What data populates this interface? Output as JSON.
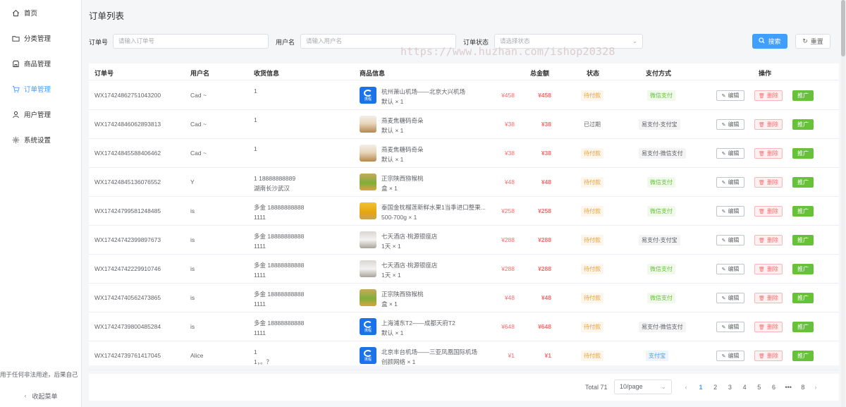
{
  "sidebar": {
    "items": [
      {
        "label": "首页",
        "icon": "home-icon"
      },
      {
        "label": "分类管理",
        "icon": "folder-icon"
      },
      {
        "label": "商品管理",
        "icon": "shop-icon"
      },
      {
        "label": "订单管理",
        "icon": "cart-icon",
        "active": true
      },
      {
        "label": "用户管理",
        "icon": "user-icon"
      },
      {
        "label": "系统设置",
        "icon": "gear-icon"
      }
    ],
    "note": "用于任何非法用途，后果自己",
    "collapse_label": "收起菜单"
  },
  "page_title": "订单列表",
  "filters": {
    "order_no_label": "订单号",
    "order_no_placeholder": "请输入订单号",
    "username_label": "用户名",
    "username_placeholder": "请输入用户名",
    "status_label": "订单状态",
    "status_placeholder": "请选择状态",
    "search_label": "搜索",
    "reset_label": "重置"
  },
  "watermark": "https://www.huzhan.com/ishop20328",
  "table": {
    "headers": [
      "订单号",
      "用户名",
      "收货信息",
      "商品信息",
      "总金额",
      "状态",
      "支付方式",
      "操作"
    ],
    "edit_label": "编辑",
    "delete_label": "删除",
    "promote_label": "推广",
    "rows": [
      {
        "order_no": "WX17424862751043200",
        "user": "Cad ~",
        "ship1": "1",
        "ship2": "",
        "thumb": "blue",
        "goods": "杭州萧山机场——北京大兴机场",
        "spec": "默认 × 1",
        "price": "¥458",
        "total": "¥458",
        "status": "待付款",
        "status_type": "pending",
        "pay": "微信支付",
        "pay_type": "green"
      },
      {
        "order_no": "WX17424846062893813",
        "user": "Cad ~",
        "ship1": "1",
        "ship2": "",
        "thumb": "cup",
        "goods": "燕麦焦糖码奇朵",
        "spec": "默认 × 1",
        "price": "¥38",
        "total": "¥38",
        "status": "已过期",
        "status_type": "expired",
        "pay": "易支付-支付宝",
        "pay_type": "gray"
      },
      {
        "order_no": "WX17424845588406462",
        "user": "Cad ~",
        "ship1": "1",
        "ship2": "",
        "thumb": "cup",
        "goods": "燕麦焦糖码奇朵",
        "spec": "默认 × 1",
        "price": "¥38",
        "total": "¥38",
        "status": "待付款",
        "status_type": "pending",
        "pay": "易支付-微信支付",
        "pay_type": "gray"
      },
      {
        "order_no": "WX17424845136076552",
        "user": "Y",
        "ship1": "1 18888888889",
        "ship2": "湖南长沙武汉",
        "thumb": "kiwi",
        "goods": "正宗陕西猕猴桃",
        "spec": "盒 × 1",
        "price": "¥48",
        "total": "¥48",
        "status": "待付款",
        "status_type": "pending",
        "pay": "微信支付",
        "pay_type": "green"
      },
      {
        "order_no": "WX17424799581248485",
        "user": "is",
        "ship1": "多金 18888888888",
        "ship2": "1111",
        "thumb": "durian",
        "goods": "泰国金枕榴莲新鲜水果1当季进口整果...",
        "spec": "500-700g × 1",
        "price": "¥258",
        "total": "¥258",
        "status": "待付款",
        "status_type": "pending",
        "pay": "微信支付",
        "pay_type": "green"
      },
      {
        "order_no": "WX17424742399897673",
        "user": "is",
        "ship1": "多金 18888888888",
        "ship2": "1111",
        "thumb": "room",
        "goods": "七天酒店·桃源银座店",
        "spec": "1天 × 1",
        "price": "¥288",
        "total": "¥288",
        "status": "待付款",
        "status_type": "pending",
        "pay": "易支付-支付宝",
        "pay_type": "gray"
      },
      {
        "order_no": "WX17424742229910746",
        "user": "is",
        "ship1": "多金 18888888888",
        "ship2": "1111",
        "thumb": "room",
        "goods": "七天酒店·桃源银座店",
        "spec": "1天 × 1",
        "price": "¥288",
        "total": "¥288",
        "status": "待付款",
        "status_type": "pending",
        "pay": "微信支付",
        "pay_type": "green"
      },
      {
        "order_no": "WX17424740562473865",
        "user": "is",
        "ship1": "多金 18888888888",
        "ship2": "1111",
        "thumb": "kiwi",
        "goods": "正宗陕西猕猴桃",
        "spec": "盒 × 1",
        "price": "¥48",
        "total": "¥48",
        "status": "待付款",
        "status_type": "pending",
        "pay": "微信支付",
        "pay_type": "green"
      },
      {
        "order_no": "WX17424739800485284",
        "user": "is",
        "ship1": "多金 18888888888",
        "ship2": "1111",
        "thumb": "blue",
        "goods": "上海浦东T2——成都天府T2",
        "spec": "默认 × 1",
        "price": "¥648",
        "total": "¥648",
        "status": "待付款",
        "status_type": "pending",
        "pay": "易支付-微信支付",
        "pay_type": "gray"
      },
      {
        "order_no": "WX17424739761417045",
        "user": "Alice",
        "ship1": "1",
        "ship2": "1，。？",
        "thumb": "blue",
        "goods": "北京丰台机场——三亚凤凰国际机场",
        "spec": "创颜网络 × 1",
        "price": "¥1",
        "total": "¥1",
        "status": "待付款",
        "status_type": "pending",
        "pay": "支付宝",
        "pay_type": "blue"
      }
    ]
  },
  "thumb_text": "携程",
  "pagination": {
    "total": "Total 71",
    "page_size": "10/page",
    "pages": [
      "1",
      "2",
      "3",
      "4",
      "5",
      "6",
      "•••",
      "8"
    ],
    "current": "1"
  },
  "colors": {
    "primary": "#409eff",
    "danger": "#f56c6c",
    "success": "#67c23a",
    "warning": "#e6a23c"
  }
}
